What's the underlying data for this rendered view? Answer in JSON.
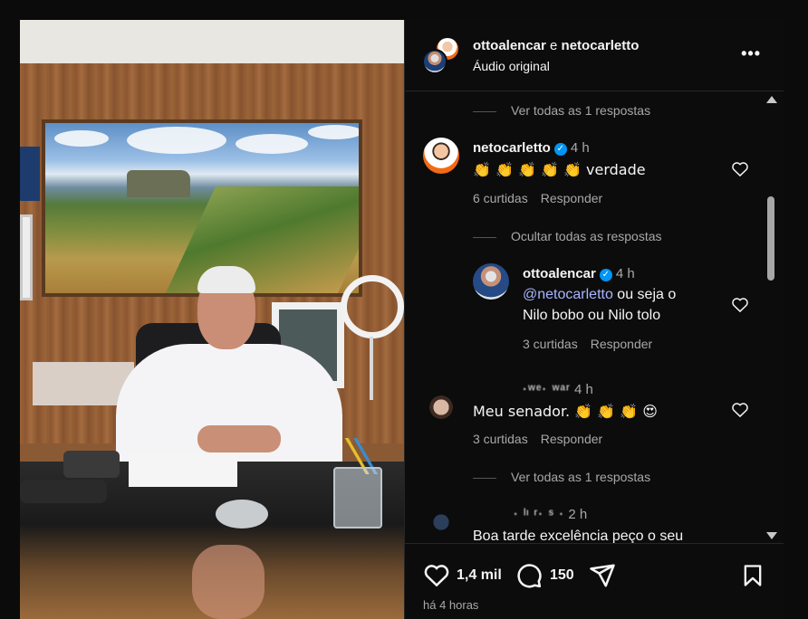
{
  "header": {
    "user1": "ottoalencar",
    "joiner": "e",
    "user2": "netocarletto",
    "audio": "Áudio original",
    "more": "•••"
  },
  "comments": {
    "view_top": "Ver todas as 1 respostas",
    "c1": {
      "user": "netocarletto",
      "time": "4 h",
      "text": "👏 👏 👏 👏 👏  verdade",
      "likes": "6 curtidas",
      "reply": "Responder"
    },
    "hide_replies": "Ocultar todas as respostas",
    "r1": {
      "user": "ottoalencar",
      "time": "4 h",
      "mention": "@netocarletto",
      "text_line1": " ou seja o",
      "text_line2": "Nilo bobo ou Nilo tolo",
      "likes": "3 curtidas",
      "reply": "Responder"
    },
    "c2": {
      "user": "·ʷᵉ· ʷᵃʳ",
      "time": "4 h",
      "text": "Meu senador. 👏 👏 👏 😍",
      "likes": "3 curtidas",
      "reply": "Responder"
    },
    "view_bottom": "Ver todas as 1 respostas",
    "c3": {
      "user": "· ˡᶦ ʳ· ˢ ·",
      "time": "2 h",
      "text": "Boa tarde excelência peço o seu"
    }
  },
  "footer": {
    "likes": "1,4 mil",
    "comments": "150",
    "ago": "há 4 horas"
  },
  "colors": {
    "background": "#0c0c0c",
    "text": "#f5f5f5",
    "secondary": "#a8a8a8",
    "verified": "#0095f6",
    "mention": "#a6b6ff"
  }
}
